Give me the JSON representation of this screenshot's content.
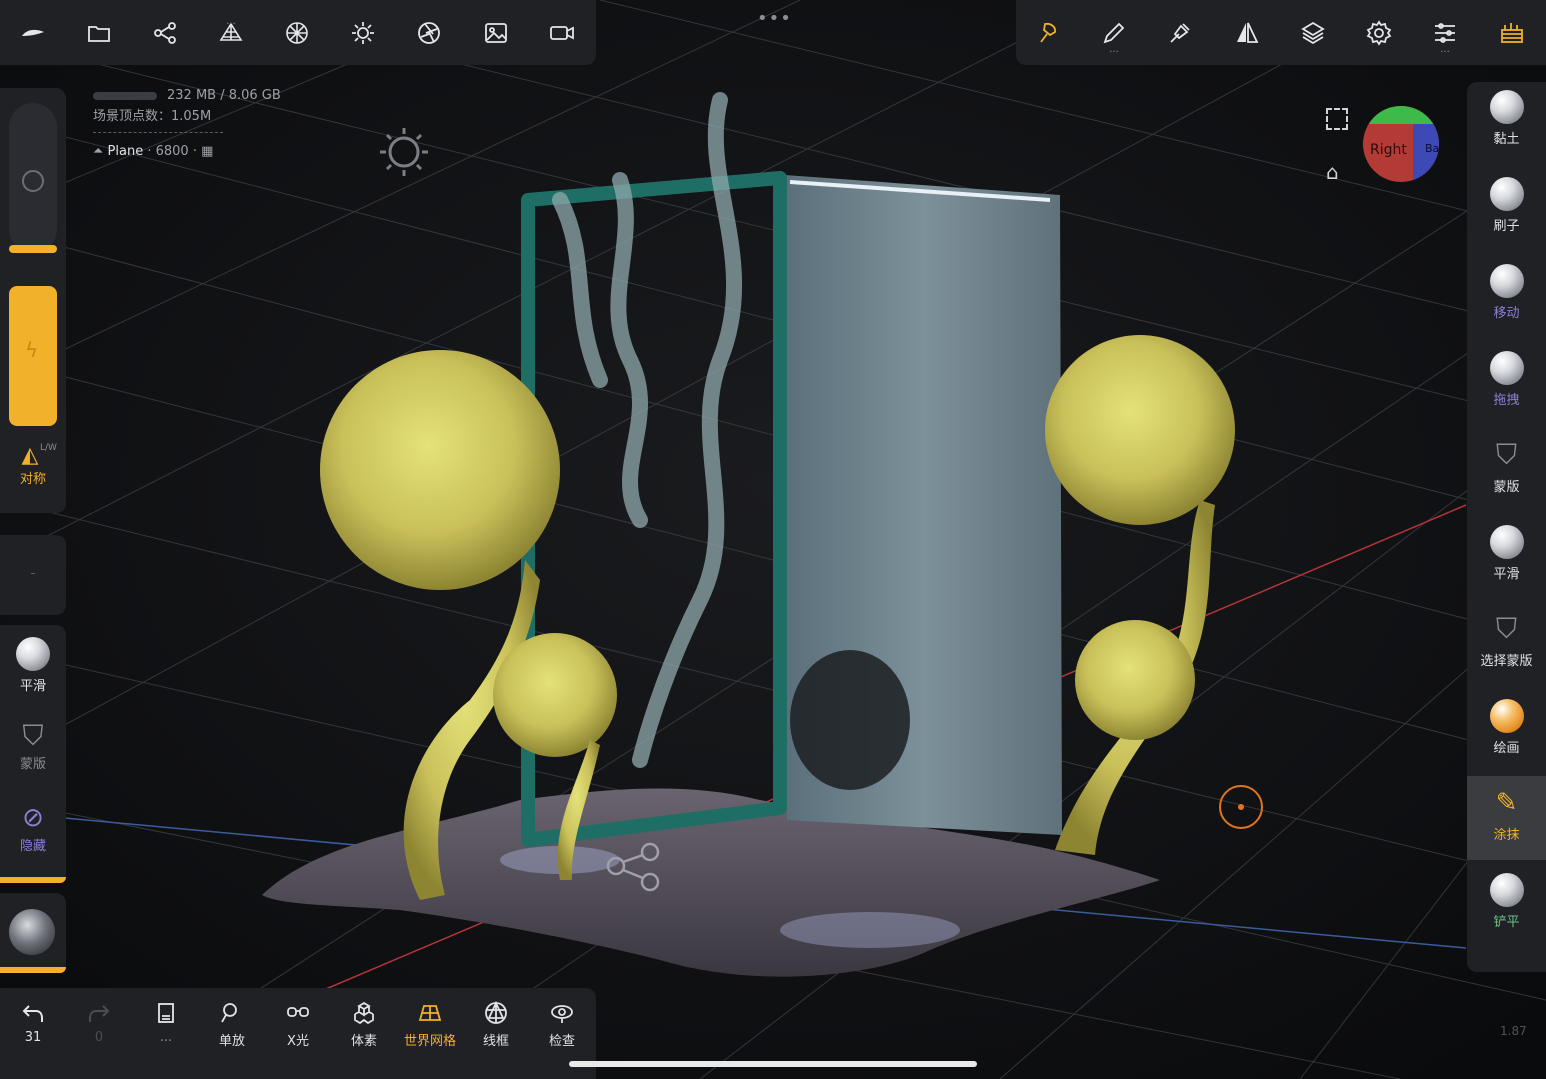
{
  "colors": {
    "accent": "#f1b12b",
    "panel": "#1f2125",
    "active_label": "#f1b12b",
    "muted_label": "#8f7fd4",
    "green_label": "#6bc48a"
  },
  "topbar_left": {
    "icons": [
      "nomad-logo-icon",
      "folder-icon",
      "share-nodes-icon",
      "mesh-pyramid-icon",
      "material-sphere-icon",
      "sun-light-icon",
      "aperture-icon",
      "image-icon",
      "video-camera-icon"
    ]
  },
  "topbar_right": {
    "icons": [
      "smudge-brush-icon",
      "pen-icon",
      "picker-icon",
      "symmetry-icon",
      "layers-icon",
      "settings-gear-icon",
      "sliders-icon",
      "scene-icon"
    ]
  },
  "stats": {
    "memory": "232 MB / 8.06 GB",
    "vertices": "场景顶点数：1.05M",
    "object_name": "Plane",
    "object_count": "· 6800 ·"
  },
  "gizmo": {
    "face_right": "Right",
    "face_back": "Ba"
  },
  "left_panel": {
    "symmetry_label": "对称",
    "symmetry_badge": "L/W",
    "smooth_label": "平滑",
    "mask_label": "蒙版",
    "hide_label": "隐藏"
  },
  "right_tools": [
    {
      "label": "黏土",
      "state": "normal"
    },
    {
      "label": "刷子",
      "state": "normal"
    },
    {
      "label": "移动",
      "state": "muted"
    },
    {
      "label": "拖拽",
      "state": "muted"
    },
    {
      "label": "蒙版",
      "state": "normal"
    },
    {
      "label": "平滑",
      "state": "normal"
    },
    {
      "label": "选择蒙版",
      "state": "normal"
    },
    {
      "label": "绘画",
      "state": "normal"
    },
    {
      "label": "涂抹",
      "state": "active"
    },
    {
      "label": "铲平",
      "state": "green"
    }
  ],
  "bottom_bar": {
    "undo_count": "31",
    "redo_count": "0",
    "items": [
      "单放",
      "X光",
      "体素",
      "世界网格",
      "线框",
      "检查"
    ],
    "active_item": "世界网格"
  },
  "version": "1.87"
}
